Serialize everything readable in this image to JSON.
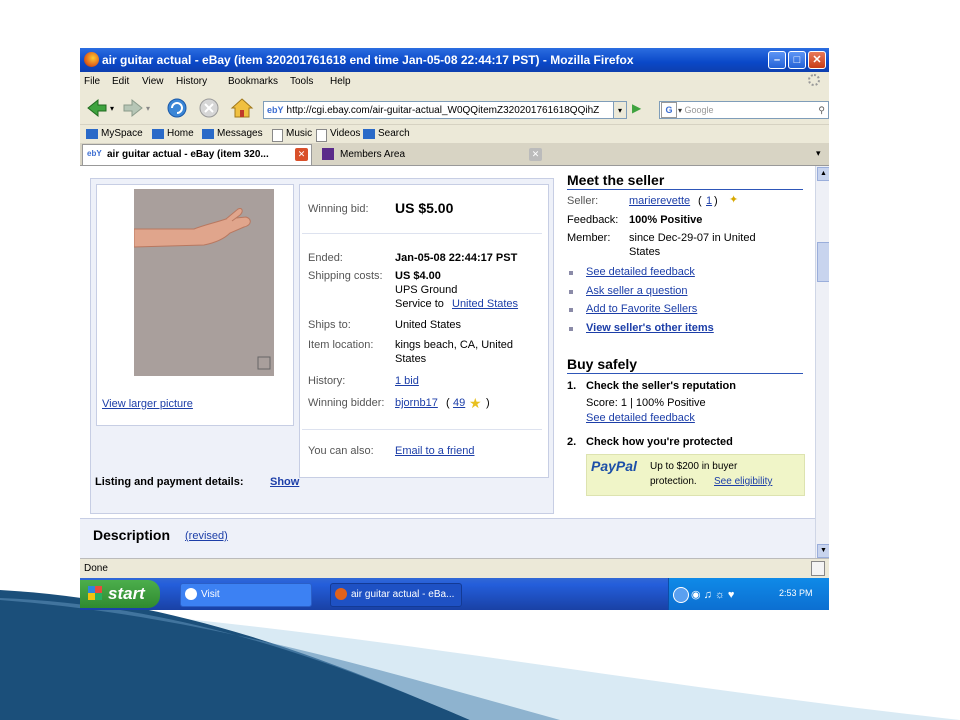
{
  "window": {
    "title": "air guitar actual - eBay (item 320201761618 end time Jan-05-08 22:44:17 PST) - Mozilla Firefox"
  },
  "menu": [
    "File",
    "Edit",
    "View",
    "History",
    "Bookmarks",
    "Tools",
    "Help"
  ],
  "toolbar": {
    "url": "http://cgi.ebay.com/air-guitar-actual_W0QQitemZ320201761618QQihZ",
    "search_placeholder": "Google",
    "search_engine_letter": "G"
  },
  "bookmarks": [
    "MySpace",
    "Home",
    "Messages",
    "Music",
    "Videos",
    "Search"
  ],
  "tabs": [
    {
      "label": "air guitar actual - eBay (item 320...",
      "active": true
    },
    {
      "label": "Members Area",
      "active": false
    }
  ],
  "item": {
    "view_larger_picture": "View larger picture",
    "winning_bid_label": "Winning bid:",
    "winning_bid_value": "US $5.00",
    "ended_label": "Ended:",
    "ended_value": "Jan-05-08 22:44:17 PST",
    "shipping_label": "Shipping costs:",
    "shipping_value": "US $4.00",
    "shipping_method": "UPS Ground",
    "shipping_service_prefix": "Service to",
    "shipping_service_link": "United States",
    "ships_to_label": "Ships to:",
    "ships_to_value": "United States",
    "location_label": "Item location:",
    "location_value_1": "kings beach, CA, United",
    "location_value_2": "States",
    "history_label": "History:",
    "history_value": "1 bid",
    "winner_label": "Winning bidder:",
    "winner_name": "bjornb17",
    "winner_open": "(",
    "winner_score": "49",
    "winner_close": ")",
    "also_label": "You can also:",
    "also_link": "Email to a friend",
    "listing_label": "Listing and payment details:",
    "listing_link": "Show"
  },
  "seller": {
    "header": "Meet the seller",
    "seller_label": "Seller:",
    "seller_name": "marierevette",
    "seller_open": "(",
    "seller_score": "1",
    "seller_close": ")",
    "feedback_label": "Feedback:",
    "feedback_value": "100% Positive",
    "member_label": "Member:",
    "member_value_1": "since Dec-29-07 in United",
    "member_value_2": "States",
    "links": [
      "See detailed feedback",
      "Ask seller a question",
      "Add to Favorite Sellers",
      "View seller's other items"
    ]
  },
  "buy_safely": {
    "header": "Buy safely",
    "step1_num": "1.",
    "step1_title": "Check the seller's reputation",
    "step1_score": "Score: 1 | 100% Positive",
    "step1_link": "See detailed feedback",
    "step2_num": "2.",
    "step2_title": "Check how you're protected",
    "paypal_logo": "PayPal",
    "paypal_text_1": "Up to $200 in buyer",
    "paypal_text_2": "protection.",
    "paypal_link": "See eligibility"
  },
  "description": {
    "label": "Description",
    "revised": "(revised)"
  },
  "status": {
    "text": "Done"
  },
  "taskbar": {
    "start": "start",
    "task1": "Visit",
    "task2": "air guitar actual - eBa...",
    "clock": "2:53 PM"
  },
  "colors": {
    "titlebar": "#0a48c8",
    "link": "#1c3ea8",
    "taskbar": "#245edb",
    "start_button": "#2f8a2f",
    "slide_accent": "#1b4f7a"
  }
}
